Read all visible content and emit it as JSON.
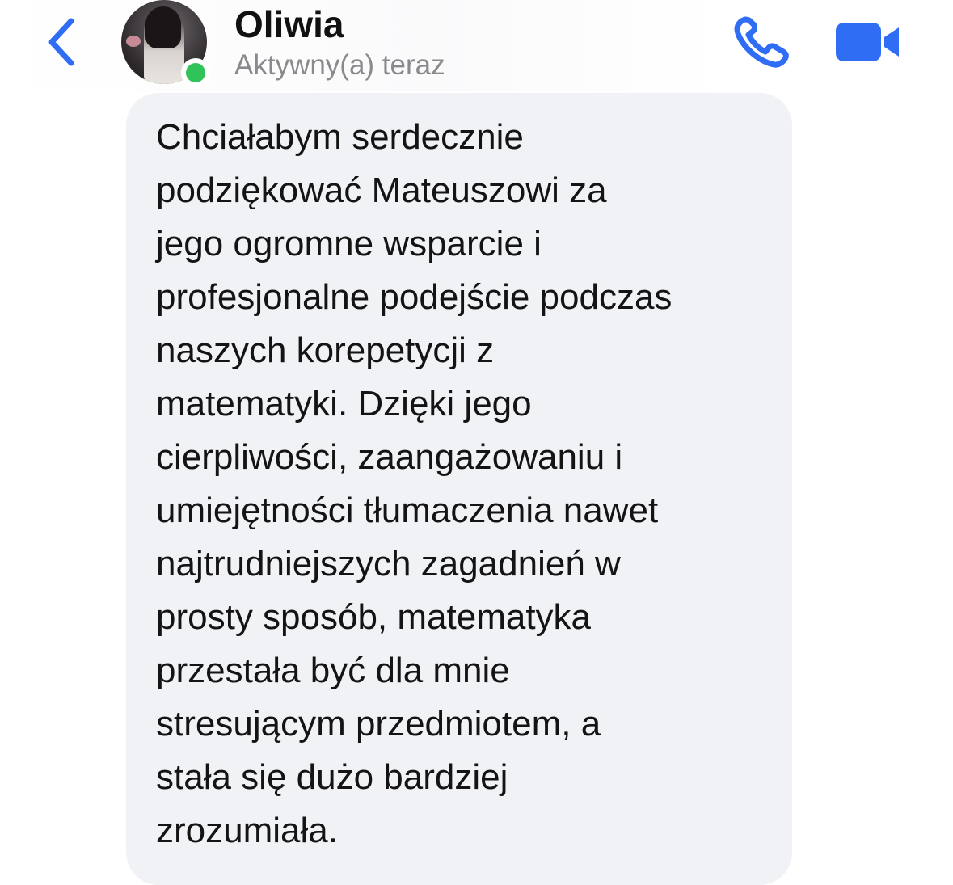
{
  "header": {
    "contact_name": "Oliwia",
    "status": "Aktywny(a) teraz",
    "back_icon": "chevron-left-icon",
    "call_icon": "phone-icon",
    "video_icon": "video-camera-icon",
    "accent_color": "#2f6df5",
    "online_color": "#30c35a"
  },
  "message": {
    "lines": [
      "Chciałabym serdecznie",
      "podziękować Mateuszowi za",
      "jego ogromne wsparcie i",
      "profesjonalne podejście podczas",
      "naszych korepetycji z",
      "matematyki. Dzięki jego",
      "cierpliwości, zaangażowaniu i",
      "umiejętności tłumaczenia nawet",
      "najtrudniejszych zagadnień w",
      "prosty sposób, matematyka",
      "przestała być dla mnie",
      "stresującym przedmiotem, a",
      "stała się dużo bardziej",
      "zrozumiała."
    ]
  }
}
